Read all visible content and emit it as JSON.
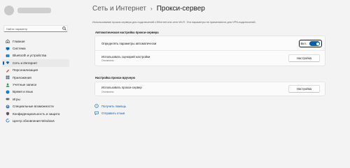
{
  "sidebar": {
    "search_placeholder": "Найти параметр",
    "items": [
      {
        "label": "Главная",
        "icon": "home-icon",
        "color": "#3a3a3a"
      },
      {
        "label": "Система",
        "icon": "system-icon",
        "color": "#0067c0"
      },
      {
        "label": "Bluetooth и устройства",
        "icon": "bluetooth-icon",
        "color": "#0067c0"
      },
      {
        "label": "Сеть и Интернет",
        "icon": "network-icon",
        "color": "#0067c0"
      },
      {
        "label": "Персонализация",
        "icon": "personalization-icon",
        "color": "#c94f2f"
      },
      {
        "label": "Приложения",
        "icon": "apps-icon",
        "color": "#4a5a7a"
      },
      {
        "label": "Учетные записи",
        "icon": "accounts-icon",
        "color": "#2d9b5a"
      },
      {
        "label": "Время и язык",
        "icon": "time-language-icon",
        "color": "#0067c0"
      },
      {
        "label": "Игры",
        "icon": "games-icon",
        "color": "#5a5a5a"
      },
      {
        "label": "Специальные возможности",
        "icon": "accessibility-icon",
        "color": "#2f6fbf"
      },
      {
        "label": "Конфиденциальность и защита",
        "icon": "privacy-icon",
        "color": "#5a5a5a"
      },
      {
        "label": "Центр обновления Windows",
        "icon": "update-icon",
        "color": "#0067c0"
      }
    ]
  },
  "header": {
    "parent": "Сеть и Интернет",
    "separator": "›",
    "current": "Прокси-сервер"
  },
  "description": "Использование прокси-сервера для подключений к Ethernet или сети Wi-Fi. Эти параметры не применяются для VPN-подключений.",
  "auto_section": {
    "title": "Автоматическая настройка прокси-сервера",
    "detect_label": "Определять параметры автоматически",
    "toggle_text": "Вкл.",
    "toggle_on": true,
    "script_title": "Использовать сценарий настройки",
    "script_status": "Отключено",
    "script_button": "Настройка"
  },
  "manual_section": {
    "title": "Настройка прокси вручную",
    "proxy_title": "Использовать прокси-сервер",
    "proxy_status": "Отключено",
    "proxy_button": "Настройка"
  },
  "links": {
    "help": "Получить помощь",
    "feedback": "Отправить отзыв"
  },
  "accent_color": "#005fb8"
}
